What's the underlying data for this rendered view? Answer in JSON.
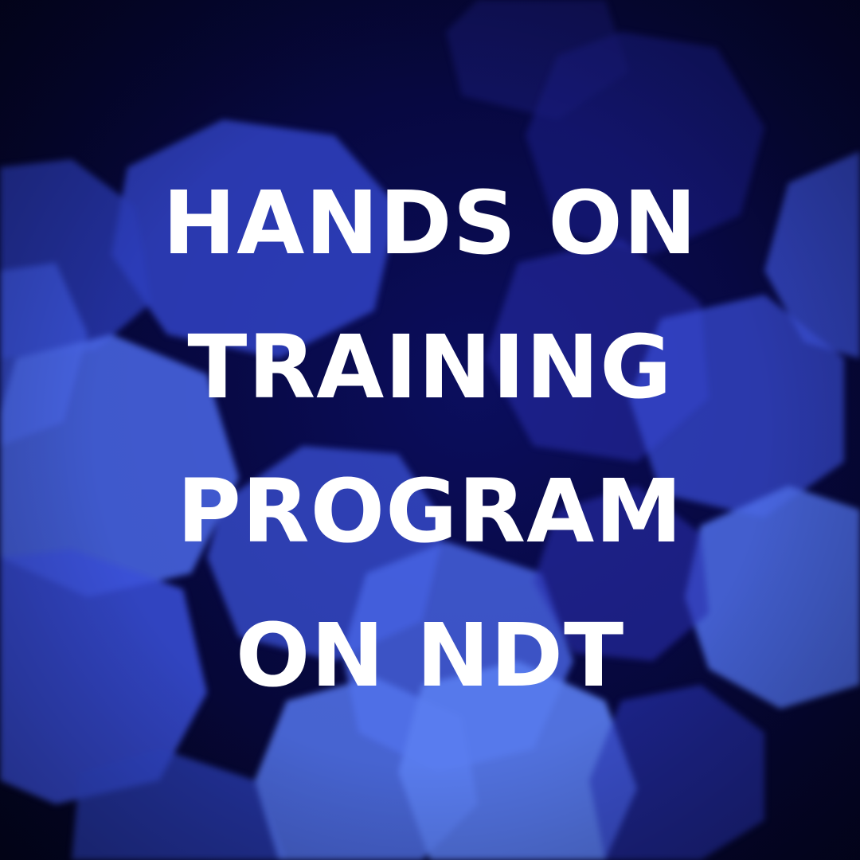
{
  "headline": {
    "line1": "HANDS ON",
    "line2": "TRAINING",
    "line3": "PROGRAM",
    "line4": "ON NDT"
  },
  "background": {
    "description_colors": {
      "base": "#04051a",
      "deep_blue": "#0b0e5e",
      "bokeh_bright": "#5a7df0",
      "bokeh_mid": "#3a4fd8",
      "bokeh_dim": "#2a2fae"
    }
  }
}
